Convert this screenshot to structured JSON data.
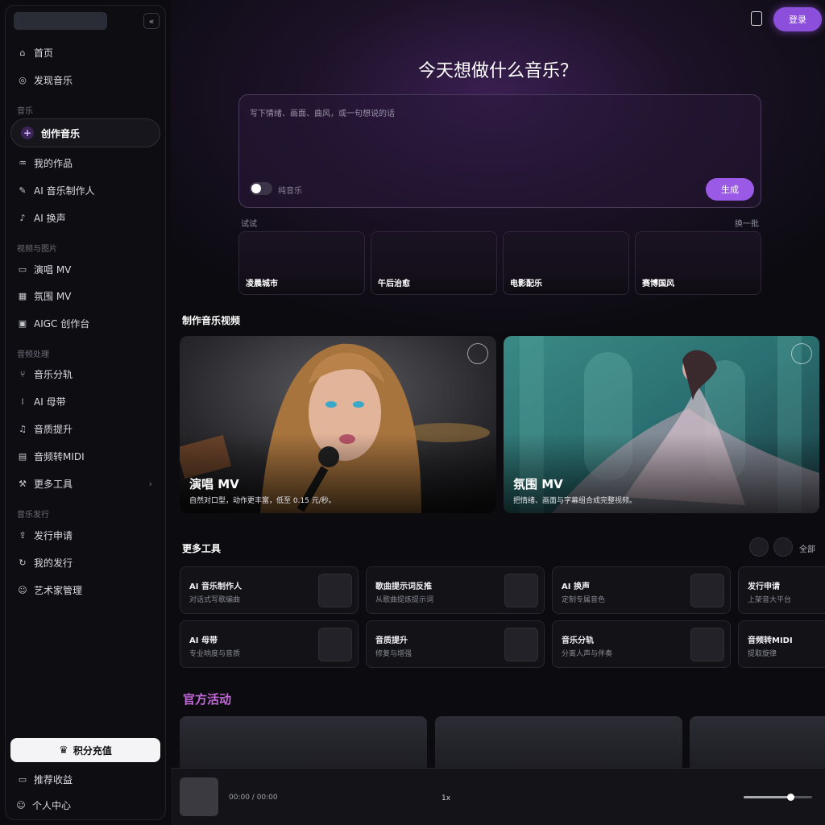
{
  "sidebar": {
    "collapse_icon": "«",
    "nav_top": [
      {
        "icon": "⌂",
        "label": "首页"
      },
      {
        "icon": "◎",
        "label": "发现音乐"
      }
    ],
    "section_music": "音乐",
    "create_label": "创作音乐",
    "music_items": [
      {
        "icon": "♒",
        "label": "我的作品"
      },
      {
        "icon": "✎",
        "label": "AI 音乐制作人"
      },
      {
        "icon": "♪",
        "label": "AI 换声"
      }
    ],
    "section_video": "视频与图片",
    "video_items": [
      {
        "icon": "▭",
        "label": "演唱 MV"
      },
      {
        "icon": "▦",
        "label": "氛围 MV"
      },
      {
        "icon": "▣",
        "label": "AIGC 创作台"
      }
    ],
    "section_audio": "音频处理",
    "audio_items": [
      {
        "icon": "⑂",
        "label": "音乐分轨"
      },
      {
        "icon": "⁞",
        "label": "AI 母带"
      },
      {
        "icon": "♫",
        "label": "音质提升"
      },
      {
        "icon": "▤",
        "label": "音频转MIDI"
      },
      {
        "icon": "⚒",
        "label": "更多工具"
      }
    ],
    "more_tools_chevron": "›",
    "section_release": "音乐发行",
    "release_items": [
      {
        "icon": "⇪",
        "label": "发行申请"
      },
      {
        "icon": "↻",
        "label": "我的发行"
      },
      {
        "icon": "☺",
        "label": "艺术家管理"
      }
    ],
    "recharge_label": "积分充值",
    "bottom_items": [
      {
        "icon": "▭",
        "label": "推荐收益"
      },
      {
        "icon": "☺",
        "label": "个人中心"
      }
    ]
  },
  "header": {
    "login_label": "登录"
  },
  "hero": {
    "title": "今天想做什么音乐？",
    "placeholder": "写下情绪、画面、曲风，或一句想说的话",
    "toggle_label": "纯音乐",
    "generate_label": "生成",
    "try_label": "试试",
    "shuffle_label": "换一批",
    "suggestions": [
      "凌晨城市",
      "午后治愈",
      "电影配乐",
      "赛博国风"
    ]
  },
  "mv_section": {
    "title": "制作音乐视频",
    "cards": [
      {
        "title": "演唱 MV",
        "desc": "自然对口型，动作更丰富，低至 0.15 元/秒。"
      },
      {
        "title": "氛围 MV",
        "desc": "把情绪、画面与字幕组合成完整视频。"
      }
    ]
  },
  "tools_section": {
    "title": "更多工具",
    "all_label": "全部",
    "cards": [
      {
        "name": "AI 音乐制作人",
        "desc": "对话式写歌编曲"
      },
      {
        "name": "歌曲提示词反推",
        "desc": "从歌曲提炼提示词"
      },
      {
        "name": "AI 换声",
        "desc": "定制专属音色"
      },
      {
        "name": "发行申请",
        "desc": "上架音大平台"
      },
      {
        "name": "AI 母带",
        "desc": "专业响度与音质"
      },
      {
        "name": "音质提升",
        "desc": "修复与增强"
      },
      {
        "name": "音乐分轨",
        "desc": "分离人声与伴奏"
      },
      {
        "name": "音频转MIDI",
        "desc": "提取旋律"
      }
    ]
  },
  "events_section": {
    "title": "官方活动"
  },
  "player": {
    "time": "00:00 / 00:00",
    "speed": "1x",
    "volume": 0.68
  },
  "colors": {
    "accent": "#8b4fdc",
    "events_title": "#c46ad8"
  }
}
